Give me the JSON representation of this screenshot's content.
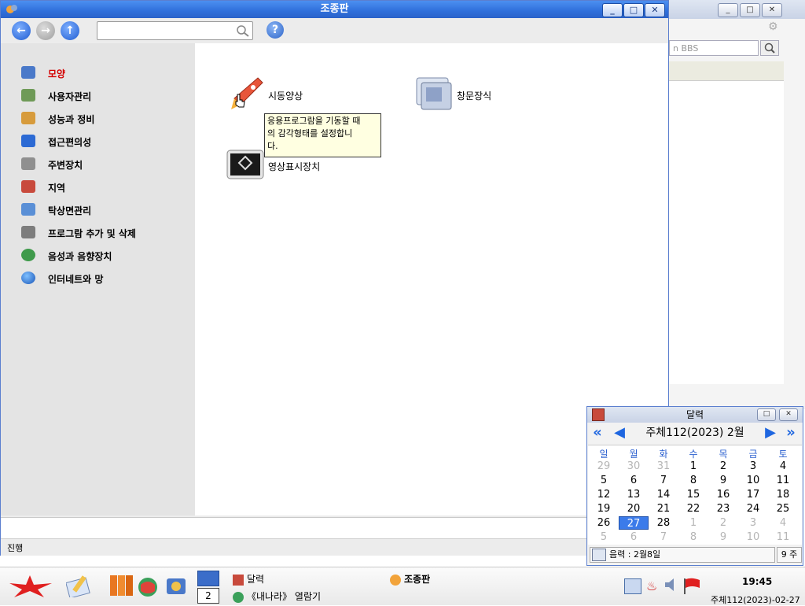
{
  "background_window": {
    "search_placeholder": "n BBS"
  },
  "main_window": {
    "title": "조종판",
    "search_value": "",
    "help_label": "?",
    "sidebar": {
      "items": [
        {
          "label": "모양",
          "icon": "appearance-icon",
          "active": true
        },
        {
          "label": "사용자관리",
          "icon": "users-icon"
        },
        {
          "label": "성능과 정비",
          "icon": "performance-icon"
        },
        {
          "label": "접근편의성",
          "icon": "accessibility-icon"
        },
        {
          "label": "주변장치",
          "icon": "peripheral-icon"
        },
        {
          "label": "지역",
          "icon": "region-icon"
        },
        {
          "label": "탁상면관리",
          "icon": "desktop-icon"
        },
        {
          "label": "프로그람 추가 및 삭제",
          "icon": "add-remove-icon"
        },
        {
          "label": "음성과 음향장치",
          "icon": "sound-icon"
        },
        {
          "label": "인터네트와 망",
          "icon": "network-icon"
        }
      ]
    },
    "content": {
      "items": [
        {
          "label": "시동양상",
          "icon": "rocket-icon"
        },
        {
          "label": "창문장식",
          "icon": "window-decoration-icon"
        },
        {
          "label": "영상표시장치",
          "icon": "display-icon"
        }
      ],
      "tooltip": [
        "응용프로그람을 기동할 때",
        "의 감각형태를 설정합니",
        "다."
      ]
    },
    "status": "진행"
  },
  "calendar": {
    "title": "달력",
    "month_label": "주체112(2023)  2월",
    "weekdays": [
      "일",
      "월",
      "화",
      "수",
      "목",
      "금",
      "토"
    ],
    "weeks": [
      [
        "29",
        "30",
        "31",
        "1",
        "2",
        "3",
        "4"
      ],
      [
        "5",
        "6",
        "7",
        "8",
        "9",
        "10",
        "11"
      ],
      [
        "12",
        "13",
        "14",
        "15",
        "16",
        "17",
        "18"
      ],
      [
        "19",
        "20",
        "21",
        "22",
        "23",
        "24",
        "25"
      ],
      [
        "26",
        "27",
        "28",
        "1",
        "2",
        "3",
        "4"
      ],
      [
        "5",
        "6",
        "7",
        "8",
        "9",
        "10",
        "11"
      ]
    ],
    "selected_day": "27",
    "lunar": "음력 : 2월8일",
    "week_number": "9 주"
  },
  "taskbar": {
    "desktop_number": "2",
    "task_calendar": "달력",
    "task_browser": "《내나라》 열람기",
    "task_control_panel": "조종판",
    "time": "19:45",
    "date": "주체112(2023)-02-27"
  },
  "colors": {
    "title_blue": "#2f6fdb",
    "active_red": "#d40000",
    "accent_blue": "#3b7bea"
  }
}
